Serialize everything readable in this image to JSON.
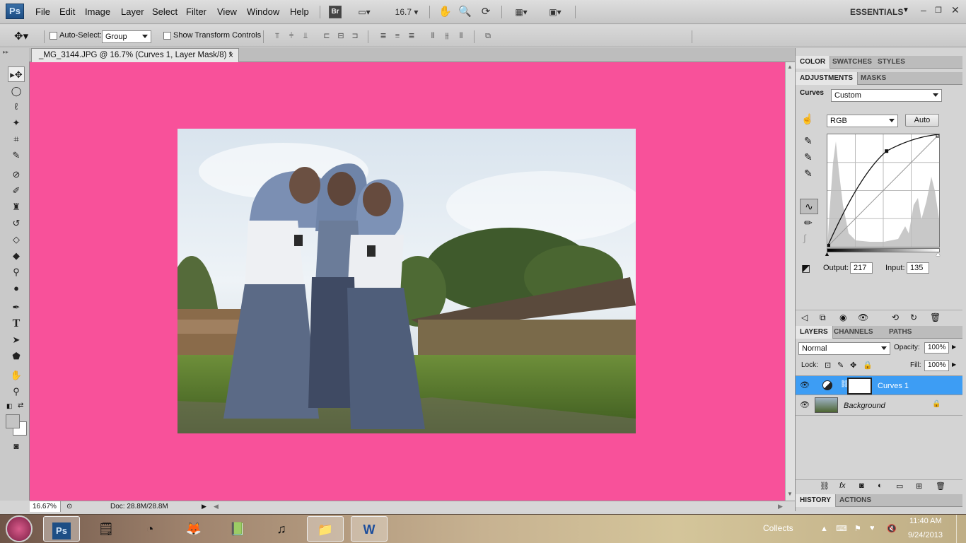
{
  "app": {
    "logo": "Ps",
    "workspace": "ESSENTIALS",
    "zoom_menu": "16.7",
    "bridge_label": "Br"
  },
  "menu": [
    "File",
    "Edit",
    "Image",
    "Layer",
    "Select",
    "Filter",
    "View",
    "Window",
    "Help"
  ],
  "options": {
    "auto_select_label": "Auto-Select:",
    "auto_select_value": "Group",
    "transform_label": "Show Transform Controls"
  },
  "document": {
    "tab_title": "_MG_3144.JPG @ 16.7% (Curves 1, Layer Mask/8) *",
    "close": "×"
  },
  "status": {
    "zoom": "16.67%",
    "doc": "Doc: 28.8M/28.8M"
  },
  "panels": {
    "top_tabs": [
      "COLOR",
      "SWATCHES",
      "STYLES"
    ],
    "adj_tabs": [
      "ADJUSTMENTS",
      "MASKS"
    ],
    "curves_label": "Curves",
    "preset": "Custom",
    "channel": "RGB",
    "auto_button": "Auto",
    "output_label": "Output:",
    "output_value": "217",
    "input_label": "Input:",
    "input_value": "135",
    "curve_point": {
      "input": 135,
      "output": 217
    },
    "layers_tabs": [
      "LAYERS",
      "CHANNELS",
      "PATHS"
    ],
    "blend_mode": "Normal",
    "opacity_label": "Opacity:",
    "opacity_value": "100%",
    "lock_label": "Lock:",
    "fill_label": "Fill:",
    "fill_value": "100%",
    "layers": [
      {
        "name": "Curves 1",
        "selected": true
      },
      {
        "name": "Background",
        "selected": false
      }
    ],
    "bottom_tabs": [
      "HISTORY",
      "ACTIONS"
    ]
  },
  "colors": {
    "canvas_bg": "#f8519a",
    "selection": "#3d9df4"
  },
  "taskbar": {
    "collects": "Collects",
    "time": "11:40 AM",
    "date": "9/24/2013"
  }
}
